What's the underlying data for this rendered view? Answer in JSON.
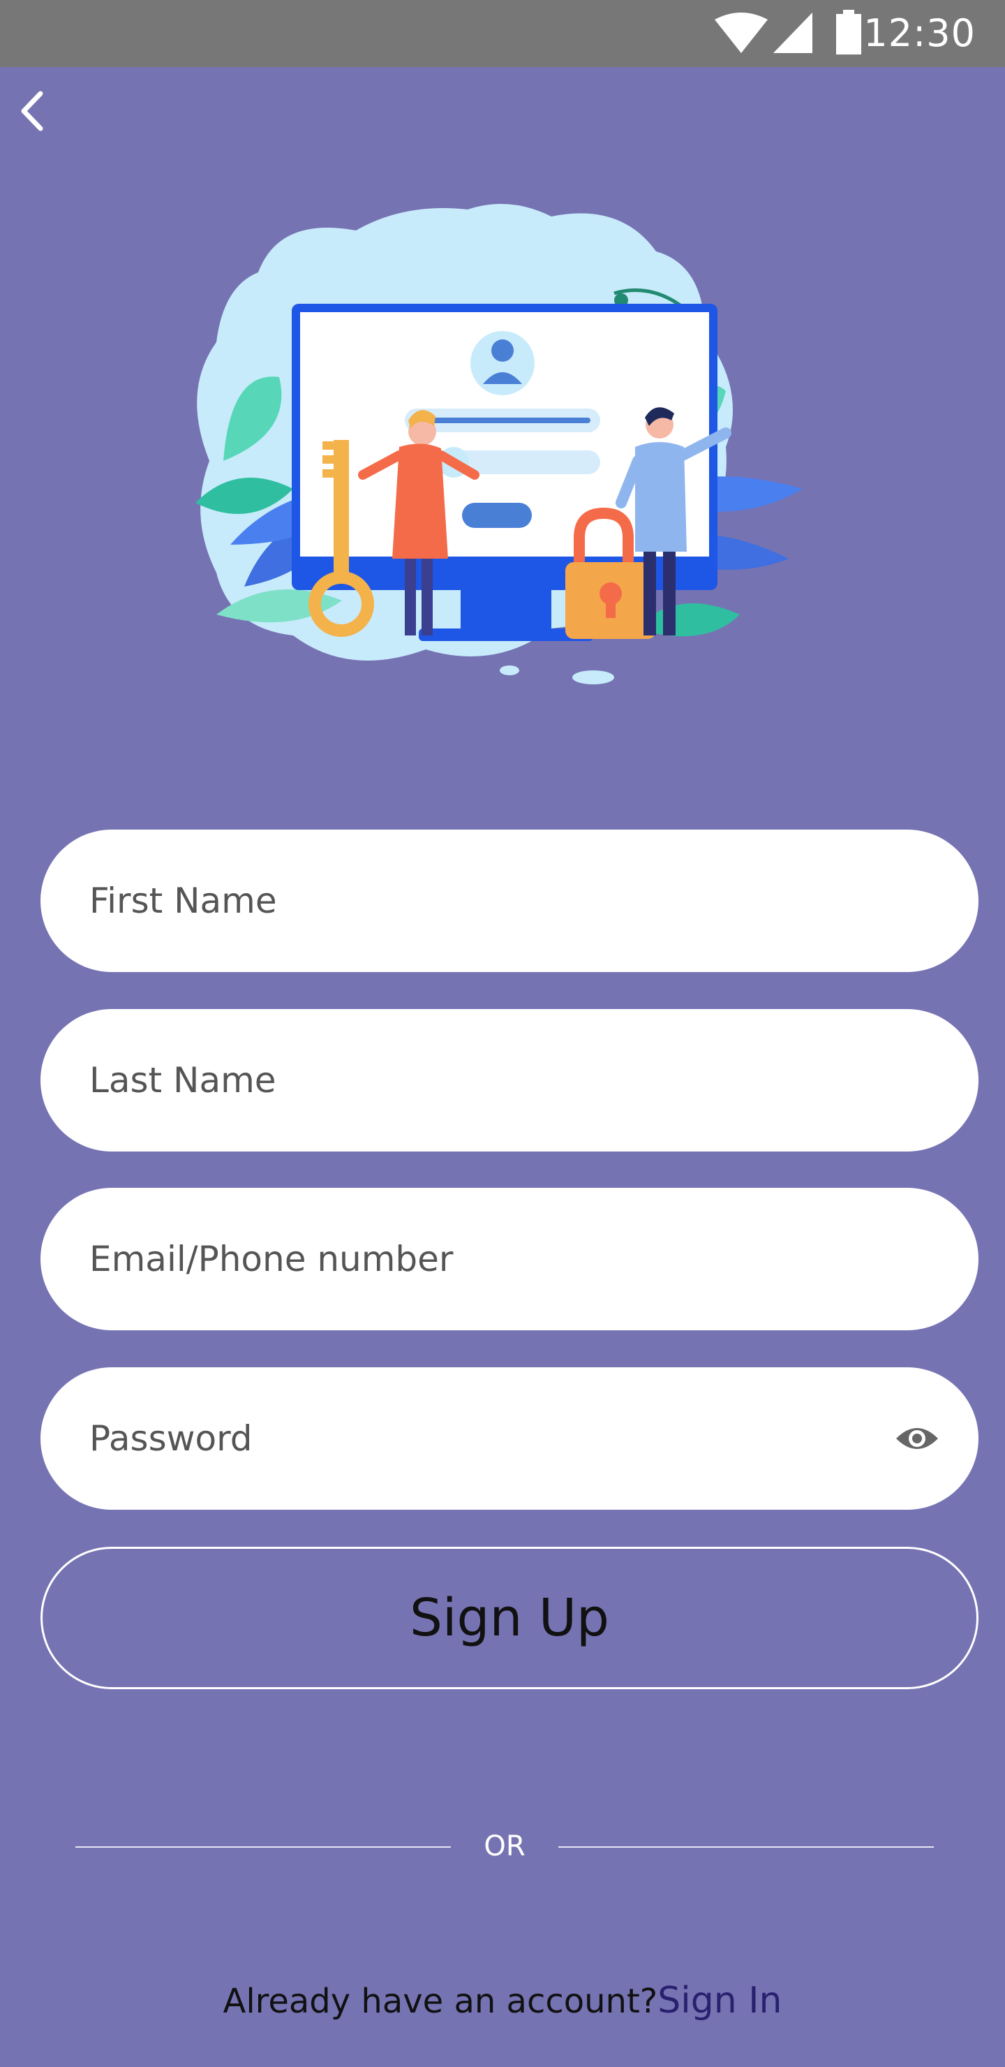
{
  "status_bar": {
    "time": "12:30",
    "icons": [
      "wifi-icon",
      "signal-icon",
      "battery-icon"
    ]
  },
  "nav": {
    "back_icon": "chevron-left-icon"
  },
  "form": {
    "first_name": {
      "placeholder": "First Name",
      "value": ""
    },
    "last_name": {
      "placeholder": "Last Name",
      "value": ""
    },
    "email": {
      "placeholder": "Email/Phone number",
      "value": ""
    },
    "password": {
      "placeholder": "Password",
      "value": "",
      "toggle_icon": "eye-icon"
    },
    "submit_label": "Sign Up"
  },
  "divider": {
    "label": "OR"
  },
  "footer": {
    "prompt": "Already have an account?",
    "link_label": "Sign In"
  },
  "colors": {
    "background": "#7673b3",
    "status_bar": "#777777",
    "field_bg": "#ffffff",
    "link": "#27216e"
  }
}
